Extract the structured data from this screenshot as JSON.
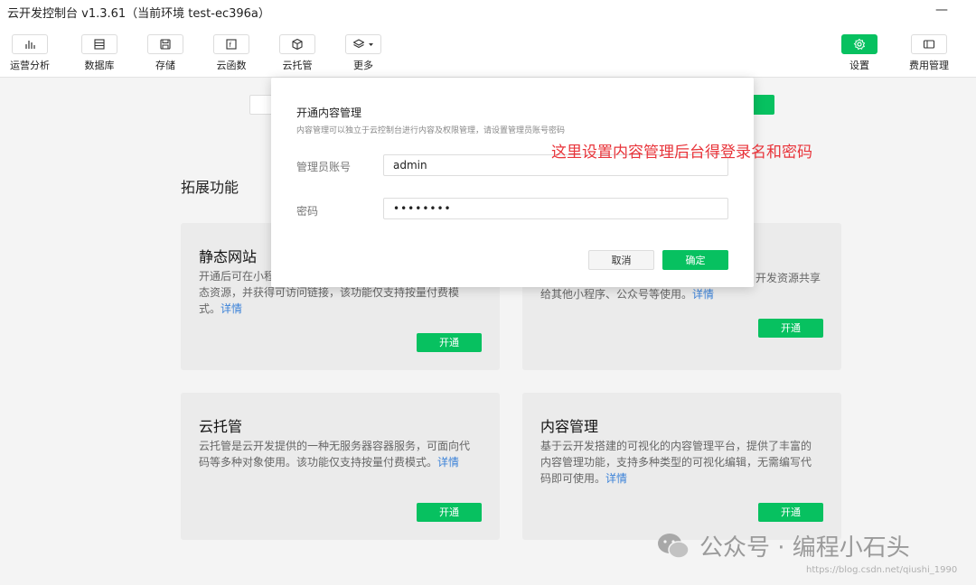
{
  "window": {
    "title": "云开发控制台 v1.3.61（当前环境 test-ec396a）",
    "minimize": "—"
  },
  "toolbar": {
    "items": [
      {
        "label": "运营分析",
        "icon": "bar-chart-icon"
      },
      {
        "label": "数据库",
        "icon": "database-icon"
      },
      {
        "label": "存储",
        "icon": "storage-icon"
      },
      {
        "label": "云函数",
        "icon": "function-icon"
      },
      {
        "label": "云托管",
        "icon": "cube-icon"
      },
      {
        "label": "更多",
        "icon": "layers-icon"
      }
    ],
    "right_items": [
      {
        "label": "设置",
        "icon": "gear-icon"
      },
      {
        "label": "费用管理",
        "icon": "billing-icon"
      }
    ],
    "accent": "#07c160"
  },
  "main": {
    "section_title": "拓展功能",
    "cards": [
      {
        "title": "静态网站",
        "desc": "开通后可在小程序中托管静态资源，并获得可访问链接，该功能仅支持按量付费模式。",
        "desc_visible": "开通后可在小程",
        "desc_rest": "态资源，并获得可访问链接，该功能仅支持按量付费模式。",
        "link": "详情",
        "button": "开通"
      },
      {
        "title": "",
        "desc_tail": "开发资源共享",
        "desc_line2": "给其他小程序、公众号等使用。",
        "link": "详情",
        "button": "开通"
      },
      {
        "title": "云托管",
        "desc": "云托管是云开发提供的一种无服务器容器服务，可面向代码等多种对象使用。该功能仅支持按量付费模式。",
        "link": "详情",
        "button": "开通"
      },
      {
        "title": "内容管理",
        "desc": "基于云开发搭建的可视化的内容管理平台，提供了丰富的内容管理功能，支持多种类型的可视化编辑，无需编写代码即可使用。",
        "link": "详情",
        "button": "开通"
      }
    ]
  },
  "modal": {
    "title": "开通内容管理",
    "subtitle": "内容管理可以独立于云控制台进行内容及权限管理，请设置管理员账号密码",
    "account_label": "管理员账号",
    "account_value": "admin",
    "password_label": "密码",
    "password_value": "••••••••",
    "cancel": "取消",
    "confirm": "确定"
  },
  "annotation": "这里设置内容管理后台得登录名和密码",
  "watermark": {
    "text": "公众号 · 编程小石头",
    "url": "https://blog.csdn.net/qiushi_1990"
  }
}
